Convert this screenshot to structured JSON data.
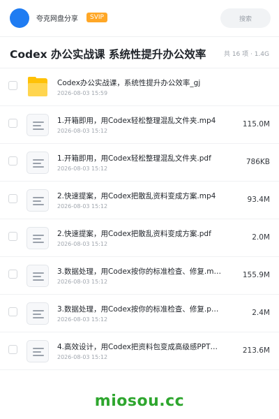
{
  "header": {
    "share_name": "夸克网盘分享",
    "badge": "SVIP",
    "search_placeholder": "搜索",
    "avatar_color": "#1f7cf2"
  },
  "folder_title": "Codex 办公实战课 系统性提升办公效率",
  "count_info": "共 16 项 · 1.4G",
  "files": [
    {
      "icon": "folder-icon",
      "name": "Codex办公实战课，系统性提升办公效率_gj",
      "date": "2026-08-03 15:59",
      "size": ""
    },
    {
      "icon": "document-icon",
      "name": "1.开箱即用，用Codex轻松整理混乱文件夹.mp4",
      "date": "2026-08-03 15:12",
      "size": "115.0M"
    },
    {
      "icon": "document-icon",
      "name": "1.开箱即用，用Codex轻松整理混乱文件夹.pdf",
      "date": "2026-08-03 15:12",
      "size": "786KB"
    },
    {
      "icon": "document-icon",
      "name": "2.快速提案，用Codex把散乱资料变成方案.mp4",
      "date": "2026-08-03 15:12",
      "size": "93.4M"
    },
    {
      "icon": "document-icon",
      "name": "2.快速提案，用Codex把散乱资料变成方案.pdf",
      "date": "2026-08-03 15:12",
      "size": "2.0M"
    },
    {
      "icon": "document-icon",
      "name": "3.数据处理，用Codex按你的标准检查、修复.m…",
      "date": "2026-08-03 15:12",
      "size": "155.9M"
    },
    {
      "icon": "document-icon",
      "name": "3.数据处理，用Codex按你的标准检查、修复.p…",
      "date": "2026-08-03 15:12",
      "size": "2.4M"
    },
    {
      "icon": "document-icon",
      "name": "4.高效设计，用Codex把资料包变成高级感PPT…",
      "date": "2026-08-03 15:12",
      "size": "213.6M"
    }
  ],
  "watermark": "miosou.cc",
  "colors": {
    "accent": "#1f7cf2",
    "svip": "#ffa726",
    "folder": "#ffc107",
    "watermark": "#2ea62e"
  }
}
